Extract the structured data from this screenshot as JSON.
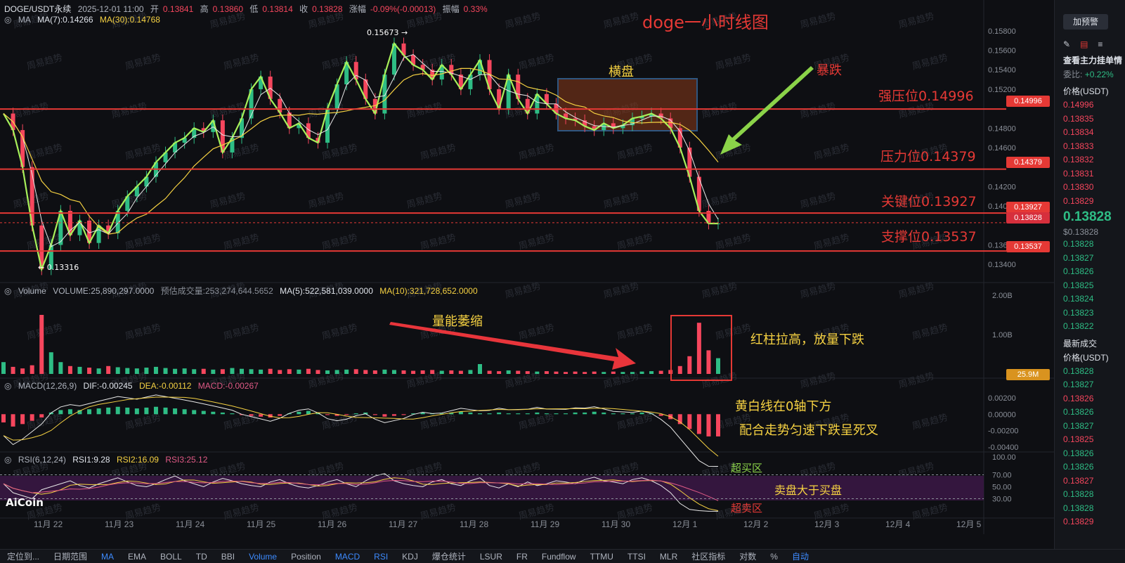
{
  "header": {
    "symbol": "DOGE/USDT永续",
    "datetime": "2025-12-01 11:00",
    "open_label": "开",
    "open": "0.13841",
    "high_label": "高",
    "high": "0.13860",
    "low_label": "低",
    "low": "0.13814",
    "close_label": "收",
    "close": "0.13828",
    "change_label": "涨幅",
    "change": "-0.09%(-0.00013)",
    "amp_label": "振幅",
    "amp": "0.33%"
  },
  "ma_line": {
    "label": "MA",
    "ma7": "MA(7):0.14266",
    "ma30": "MA(30):0.14768"
  },
  "volume_line": {
    "label": "Volume",
    "vol": "VOLUME:25,890,297.0000",
    "est": "预估成交量:253,274,644.5652",
    "ma5": "MA(5):522,581,039.0000",
    "ma10": "MA(10):321,728,652.0000"
  },
  "macd_line": {
    "label": "MACD(12,26,9)",
    "dif": "DIF:-0.00245",
    "dea": "DEA:-0.00112",
    "macd": "MACD:-0.00267"
  },
  "rsi_line": {
    "label": "RSI(6,12,24)",
    "rsi1": "RSI1:9.28",
    "rsi2": "RSI2:16.09",
    "rsi3": "RSI3:25.12"
  },
  "annotations": {
    "title": "doge一小时线图",
    "consolidation": "横盘",
    "crash": "暴跌",
    "strong_resist": "强压位0.14996",
    "resist": "压力位0.14379",
    "key": "关键位0.13927",
    "support": "支撑位0.13537",
    "volume_shrink": "量能萎缩",
    "red_bar": "红柱拉高，放量下跌",
    "macd_note1": "黄白线在0轴下方",
    "macd_note2": "配合走势匀速下跌呈死叉",
    "overbought": "超买区",
    "sell_gt_buy": "卖盘大于买盘",
    "oversold": "超卖区",
    "high_mark": "0.15673",
    "low_mark": "0.13316",
    "watermark": "周易趋势"
  },
  "price_tags": {
    "p1": "0.14996",
    "p2": "0.14379",
    "p3": "0.13927",
    "p4": "0.13828",
    "p5": "0.13537",
    "vol_tag": "25.9M"
  },
  "colors": {
    "up": "#2ebd85",
    "down": "#f6465d",
    "accent": "#e53935",
    "yellow": "#f5d142",
    "green_line": "#a8f05a",
    "blue_box": "#4a90d9"
  },
  "chart_data": {
    "type": "candlestick",
    "title": "doge一小时线图",
    "price_axis": {
      "ticks": [
        "0.15800",
        "0.15600",
        "0.15400",
        "0.15200",
        "0.14800",
        "0.14600",
        "0.14200",
        "0.14000",
        "0.13600",
        "0.13400"
      ],
      "ylim": [
        0.133,
        0.159
      ]
    },
    "x_ticks": [
      "11月 22",
      "11月 23",
      "11月 24",
      "11月 25",
      "11月 26",
      "11月 27",
      "11月 28",
      "11月 29",
      "11月 30",
      "12月 1",
      "12月 2",
      "12月 3",
      "12月 4",
      "12月 5"
    ],
    "close_path": [
      0.1495,
      0.1478,
      0.144,
      0.138,
      0.1335,
      0.136,
      0.1395,
      0.137,
      0.1385,
      0.1362,
      0.138,
      0.1372,
      0.1395,
      0.141,
      0.142,
      0.143,
      0.1445,
      0.1455,
      0.1465,
      0.147,
      0.148,
      0.1476,
      0.1488,
      0.1455,
      0.147,
      0.149,
      0.152,
      0.1533,
      0.151,
      0.1496,
      0.148,
      0.1485,
      0.147,
      0.1465,
      0.15,
      0.1525,
      0.1548,
      0.153,
      0.151,
      0.1495,
      0.1535,
      0.1567,
      0.1555,
      0.1545,
      0.154,
      0.153,
      0.1545,
      0.1535,
      0.152,
      0.1535,
      0.155,
      0.152,
      0.15,
      0.1535,
      0.151,
      0.1495,
      0.1515,
      0.1505,
      0.1495,
      0.149,
      0.1488,
      0.1482,
      0.1478,
      0.1485,
      0.148,
      0.1483,
      0.149,
      0.1492,
      0.1495,
      0.149,
      0.148,
      0.146,
      0.143,
      0.1395,
      0.1382,
      0.1382
    ],
    "horizontal_levels": [
      {
        "label": "强压位",
        "value": 0.14996
      },
      {
        "label": "压力位",
        "value": 0.14379
      },
      {
        "label": "关键位",
        "value": 0.13927
      },
      {
        "label": "支撑位",
        "value": 0.13537
      }
    ],
    "volume_axis": {
      "ticks": [
        "2.00B",
        "1.00B"
      ],
      "ylim": [
        0,
        2.0
      ]
    },
    "volume_values": [
      0.3,
      0.18,
      0.14,
      0.22,
      1.5,
      0.55,
      0.3,
      0.2,
      0.18,
      0.16,
      0.14,
      0.2,
      0.17,
      0.15,
      0.14,
      0.16,
      0.18,
      0.15,
      0.13,
      0.14,
      0.12,
      0.13,
      0.11,
      0.12,
      0.15,
      0.13,
      0.12,
      0.11,
      0.13,
      0.1,
      0.12,
      0.11,
      0.13,
      0.1,
      0.09,
      0.1,
      0.11,
      0.12,
      0.1,
      0.09,
      0.11,
      0.1,
      0.09,
      0.08,
      0.09,
      0.1,
      0.08,
      0.09,
      0.08,
      0.1,
      0.25,
      0.08,
      0.07,
      0.09,
      0.08,
      0.07,
      0.06,
      0.07,
      0.06,
      0.05,
      0.06,
      0.05,
      0.06,
      0.05,
      0.06,
      0.05,
      0.05,
      0.06,
      0.07,
      0.08,
      0.1,
      0.2,
      0.45,
      1.3,
      0.6,
      0.4
    ],
    "macd_axis": {
      "ticks": [
        "0.00200",
        "0.00000",
        "-0.00200",
        "-0.00400"
      ],
      "ylim": [
        -0.0045,
        0.0025
      ]
    },
    "macd_hist": [
      -0.001,
      -0.0015,
      -0.0012,
      -0.0008,
      -0.0004,
      0.0002,
      0.0005,
      0.0006,
      0.0005,
      0.0006,
      0.0007,
      0.0008,
      0.0009,
      0.0008,
      0.0007,
      0.0008,
      0.0009,
      0.0008,
      0.0007,
      0.0006,
      0.0005,
      0.0004,
      0.0003,
      0.0002,
      0.0001,
      -0.0001,
      -0.0002,
      -0.0003,
      -0.0004,
      -0.0002,
      0.0001,
      0.0003,
      0.0004,
      0.0002,
      -0.0001,
      -0.0002,
      -0.0001,
      0.0001,
      0.0002,
      -0.0001,
      -0.0003,
      -0.0002,
      -0.0001,
      0.0001,
      0.0002,
      0.0001,
      0.0001,
      0.0002,
      0.0003,
      0.0002,
      0.0001,
      0.0001,
      0.0002,
      0.0001,
      0.0001,
      0.0001,
      0.0002,
      0.0001,
      0.0001,
      0.0001,
      0.0002,
      0.0002,
      0.0003,
      0.0002,
      0.0001,
      0.0001,
      0.0001,
      0.0002,
      0.0001,
      -0.0002,
      -0.0006,
      -0.0012,
      -0.0018,
      -0.0024,
      -0.0027,
      -0.0027
    ],
    "rsi_axis": {
      "ticks": [
        "100.00",
        "70.00",
        "50.00",
        "30.00"
      ],
      "ylim": [
        0,
        100
      ]
    },
    "rsi_path": [
      55,
      40,
      35,
      30,
      45,
      50,
      55,
      60,
      52,
      48,
      55,
      60,
      65,
      58,
      52,
      50,
      55,
      62,
      68,
      60,
      55,
      50,
      58,
      64,
      60,
      55,
      52,
      50,
      58,
      62,
      55,
      50,
      48,
      52,
      58,
      62,
      55,
      50,
      60,
      68,
      72,
      60,
      55,
      52,
      50,
      58,
      62,
      55,
      52,
      60,
      65,
      52,
      48,
      55,
      50,
      58,
      52,
      55,
      60,
      58,
      55,
      62,
      66,
      60,
      58,
      55,
      62,
      65,
      60,
      52,
      40,
      22,
      12,
      10,
      9,
      9
    ]
  },
  "right_panel": {
    "btn_alert": "加预警",
    "book_title": "查看主力挂单情",
    "ratio_label": "委比:",
    "ratio": "+0.22%",
    "price_header": "价格(USDT)",
    "asks": [
      "0.14996",
      "0.13835",
      "0.13834",
      "0.13833",
      "0.13832",
      "0.13831",
      "0.13830",
      "0.13829"
    ],
    "last_price": "0.13828",
    "last_usd": "$0.13828",
    "bids": [
      "0.13828",
      "0.13827",
      "0.13826",
      "0.13825",
      "0.13824",
      "0.13823",
      "0.13822"
    ],
    "trades_title": "最新成交",
    "trades_header": "价格(USDT)",
    "trades": [
      "0.13828",
      "0.13827",
      "0.13826",
      "0.13826",
      "0.13827",
      "0.13825",
      "0.13826",
      "0.13826",
      "0.13827",
      "0.13828",
      "0.13828",
      "0.13829"
    ]
  },
  "bottom_bar": {
    "items": [
      "定位到...",
      "日期范围",
      "MA",
      "EMA",
      "BOLL",
      "TD",
      "BBI",
      "Volume",
      "Position",
      "MACD",
      "RSI",
      "KDJ",
      "爆仓统计",
      "LSUR",
      "FR",
      "Fundflow",
      "TTMU",
      "TTSI",
      "MLR",
      "社区指标",
      "对数",
      "%",
      "自动"
    ]
  },
  "logo": "AiCoin"
}
